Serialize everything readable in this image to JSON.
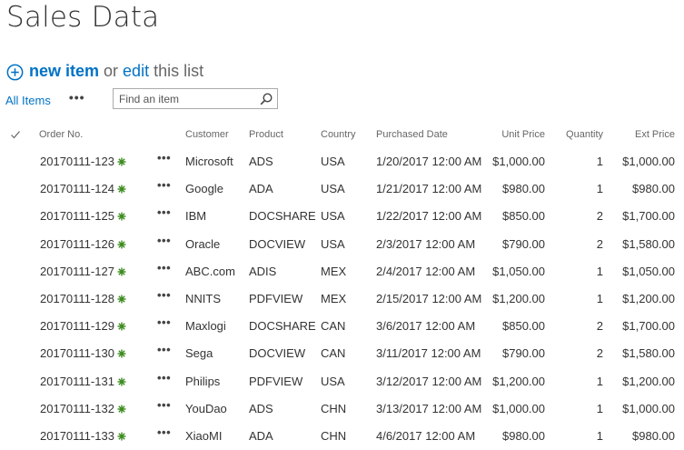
{
  "page": {
    "title": "Sales Data"
  },
  "actions": {
    "new_item": "new item",
    "or": "or",
    "edit": "edit",
    "edit_rest": "this list"
  },
  "view": {
    "current_view": "All Items",
    "more": "•••",
    "search_placeholder": "Find an item"
  },
  "colors": {
    "link": "#0072c6",
    "new_badge": "#3a8a1c"
  },
  "table": {
    "columns": [
      "Order No.",
      "Customer",
      "Product",
      "Country",
      "Purchased Date",
      "Unit Price",
      "Quantity",
      "Ext Price"
    ],
    "row_menu": "•••",
    "rows": [
      {
        "order": "20170111-123",
        "customer": "Microsoft",
        "product": "ADS",
        "country": "USA",
        "date": "1/20/2017 12:00 AM",
        "unit_price": "$1,000.00",
        "quantity": "1",
        "ext_price": "$1,000.00"
      },
      {
        "order": "20170111-124",
        "customer": "Google",
        "product": "ADA",
        "country": "USA",
        "date": "1/21/2017 12:00 AM",
        "unit_price": "$980.00",
        "quantity": "1",
        "ext_price": "$980.00"
      },
      {
        "order": "20170111-125",
        "customer": "IBM",
        "product": "DOCSHARE",
        "country": "USA",
        "date": "1/22/2017 12:00 AM",
        "unit_price": "$850.00",
        "quantity": "2",
        "ext_price": "$1,700.00"
      },
      {
        "order": "20170111-126",
        "customer": "Oracle",
        "product": "DOCVIEW",
        "country": "USA",
        "date": "2/3/2017 12:00 AM",
        "unit_price": "$790.00",
        "quantity": "2",
        "ext_price": "$1,580.00"
      },
      {
        "order": "20170111-127",
        "customer": "ABC.com",
        "product": "ADIS",
        "country": "MEX",
        "date": "2/4/2017 12:00 AM",
        "unit_price": "$1,050.00",
        "quantity": "1",
        "ext_price": "$1,050.00"
      },
      {
        "order": "20170111-128",
        "customer": "NNITS",
        "product": "PDFVIEW",
        "country": "MEX",
        "date": "2/15/2017 12:00 AM",
        "unit_price": "$1,200.00",
        "quantity": "1",
        "ext_price": "$1,200.00"
      },
      {
        "order": "20170111-129",
        "customer": "Maxlogi",
        "product": "DOCSHARE",
        "country": "CAN",
        "date": "3/6/2017 12:00 AM",
        "unit_price": "$850.00",
        "quantity": "2",
        "ext_price": "$1,700.00"
      },
      {
        "order": "20170111-130",
        "customer": "Sega",
        "product": "DOCVIEW",
        "country": "CAN",
        "date": "3/11/2017 12:00 AM",
        "unit_price": "$790.00",
        "quantity": "2",
        "ext_price": "$1,580.00"
      },
      {
        "order": "20170111-131",
        "customer": "Philips",
        "product": "PDFVIEW",
        "country": "USA",
        "date": "3/12/2017 12:00 AM",
        "unit_price": "$1,200.00",
        "quantity": "1",
        "ext_price": "$1,200.00"
      },
      {
        "order": "20170111-132",
        "customer": "YouDao",
        "product": "ADS",
        "country": "CHN",
        "date": "3/13/2017 12:00 AM",
        "unit_price": "$1,000.00",
        "quantity": "1",
        "ext_price": "$1,000.00"
      },
      {
        "order": "20170111-133",
        "customer": "XiaoMI",
        "product": "ADA",
        "country": "CHN",
        "date": "4/6/2017 12:00 AM",
        "unit_price": "$980.00",
        "quantity": "1",
        "ext_price": "$980.00"
      }
    ]
  }
}
